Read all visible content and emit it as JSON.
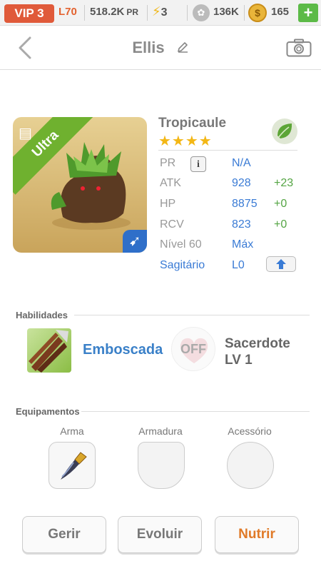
{
  "topbar": {
    "vip": "VIP 3",
    "level": "L70",
    "power": "518.2K",
    "power_unit": "PR",
    "energy": "3",
    "paws": "136K",
    "coins": "165",
    "add": "+"
  },
  "header": {
    "title": "Ellis"
  },
  "monster": {
    "rarity": "Ultra",
    "species": "Tropicaule",
    "stars": "★★★★",
    "stars_count": 4,
    "element_color": "#5ca536",
    "stats": {
      "pr_label": "PR",
      "pr_value": "N/A",
      "atk_label": "ATK",
      "atk_value": "928",
      "atk_bonus": "+23",
      "hp_label": "HP",
      "hp_value": "8875",
      "hp_bonus": "+0",
      "rcv_label": "RCV",
      "rcv_value": "823",
      "rcv_bonus": "+0",
      "level_label": "Nível 60",
      "level_value": "Máx",
      "sign_label": "Sagitário",
      "sign_value": "L0"
    }
  },
  "skills": {
    "section_label": "Habilidades",
    "active_name": "Emboscada",
    "leader_state": "OFF",
    "leader_name_line1": "Sacerdote",
    "leader_name_line2": "LV 1"
  },
  "equipment": {
    "section_label": "Equipamentos",
    "weapon_label": "Arma",
    "armor_label": "Armadura",
    "accessory_label": "Acessório"
  },
  "actions": {
    "manage": "Gerir",
    "evolve": "Evoluir",
    "feed": "Nutrir"
  },
  "colors": {
    "vip_bg": "#e05a3a",
    "accent_blue": "#3a7bd5",
    "bonus_green": "#55a544",
    "feed_orange": "#e07a28"
  }
}
